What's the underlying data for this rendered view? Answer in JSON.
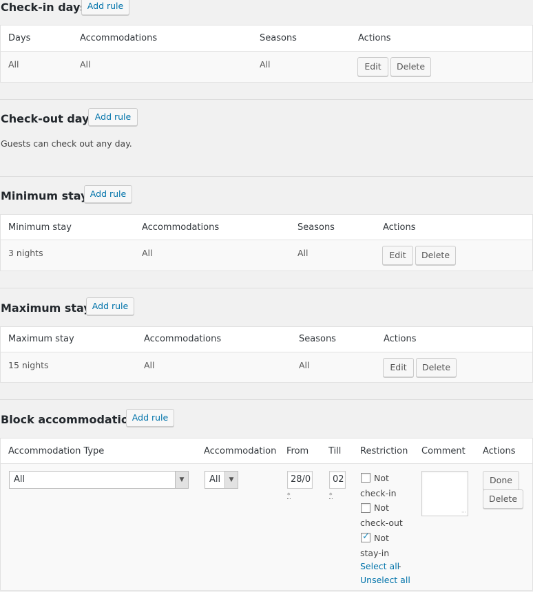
{
  "checkin": {
    "title": "Check-in days",
    "add_rule": "Add rule",
    "headers": [
      "Days",
      "Accommodations",
      "Seasons",
      "Actions"
    ],
    "row": [
      "All",
      "All",
      "All"
    ],
    "edit": "Edit",
    "delete": "Delete"
  },
  "checkout": {
    "title": "Check-out days",
    "add_rule": "Add rule",
    "note": "Guests can check out any day."
  },
  "minstay": {
    "title": "Minimum stay",
    "add_rule": "Add rule",
    "headers": [
      "Minimum stay",
      "Accommodations",
      "Seasons",
      "Actions"
    ],
    "row": [
      "3 nights",
      "All",
      "All"
    ],
    "edit": "Edit",
    "delete": "Delete"
  },
  "maxstay": {
    "title": "Maximum stay",
    "add_rule": "Add rule",
    "headers": [
      "Maximum stay",
      "Accommodations",
      "Seasons",
      "Actions"
    ],
    "row": [
      "15 nights",
      "All",
      "All"
    ],
    "edit": "Edit",
    "delete": "Delete"
  },
  "block": {
    "title": "Block accommodation",
    "add_rule": "Add rule",
    "headers": [
      "Accommodation Type",
      "Accommodation",
      "From",
      "Till",
      "Restriction",
      "Comment",
      "Actions"
    ],
    "acc_type_value": "All",
    "acc_value": "All",
    "from_value": "28/0",
    "till_value": "02",
    "required_mark": "*",
    "restrictions": [
      {
        "label1": "Not",
        "label2": "check-in",
        "checked": false
      },
      {
        "label1": "Not",
        "label2": "check-out",
        "checked": false
      },
      {
        "label1": "Not",
        "label2": "stay-in",
        "checked": true
      }
    ],
    "select_all": "Select all",
    "dash": "-",
    "unselect_all": "Unselect all",
    "done": "Done",
    "delete": "Delete"
  },
  "icons": {
    "dropdown": "chevron-down-icon",
    "check": "checkmark-icon",
    "resize": "resize-grip-icon"
  },
  "colors": {
    "link": "#0073aa",
    "background": "#f1f1f1",
    "table_bg": "#ffffff"
  }
}
